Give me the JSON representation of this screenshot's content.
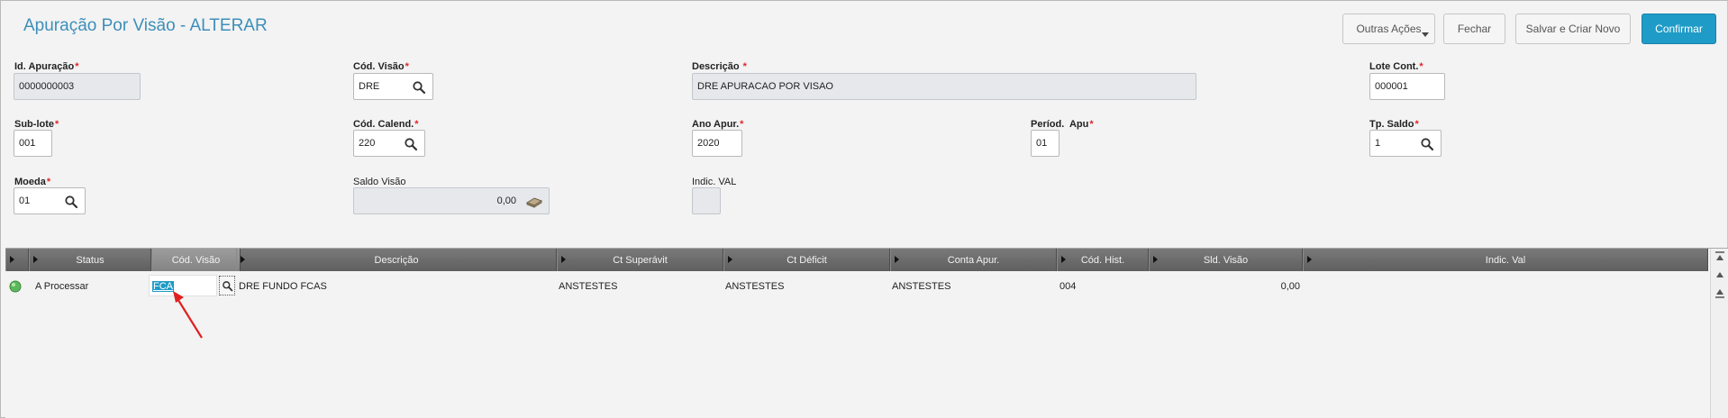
{
  "header": {
    "title": "Apuração Por Visão - ALTERAR",
    "buttons": {
      "outras_acoes": "Outras Ações",
      "fechar": "Fechar",
      "salvar_criar": "Salvar e Criar Novo",
      "confirmar": "Confirmar"
    }
  },
  "form": {
    "id_apuracao": {
      "label": "Id. Apuração",
      "value": "0000000003"
    },
    "cod_visao": {
      "label": "Cód. Visão",
      "value": "DRE"
    },
    "descricao": {
      "label": "Descrição ",
      "value": "DRE APURACAO POR VISAO"
    },
    "lote_cont": {
      "label": "Lote Cont.",
      "value": "000001"
    },
    "sub_lote": {
      "label": "Sub-lote",
      "value": "001"
    },
    "cod_calend": {
      "label": "Cód. Calend.",
      "value": "220"
    },
    "ano_apur": {
      "label": "Ano Apur.",
      "value": "2020"
    },
    "period_apu": {
      "label": "Períod.  Apu",
      "value": "01"
    },
    "tp_saldo": {
      "label": "Tp. Saldo",
      "value": "1"
    },
    "moeda": {
      "label": "Moeda",
      "value": "01"
    },
    "saldo_visao": {
      "label": "Saldo Visão",
      "value": "0,00"
    },
    "indic_val": {
      "label": "Indic. VAL",
      "value": ""
    },
    "required_mark": "*"
  },
  "grid": {
    "columns": [
      "Status",
      "Cód. Visão",
      "Descrição",
      "Ct Superávit",
      "Ct Déficit",
      "Conta Apur.",
      "Cód. Hist.",
      "Sld. Visão",
      "Indic. Val"
    ],
    "rows": [
      {
        "status": "A Processar",
        "status_color": "#5cb85c",
        "cod_visao": "FCA",
        "descricao": "DRE FUNDO FCAS",
        "ct_superavit": "ANSTESTES",
        "ct_deficit": "ANSTESTES",
        "conta_apur": "ANSTESTES",
        "cod_hist": "004",
        "sld_visao": "0,00",
        "indic_val": ""
      }
    ]
  },
  "colors": {
    "accent": "#1f9bc7",
    "title": "#3c8fba",
    "required": "#e0262b",
    "annotation_arrow": "#e02020"
  }
}
